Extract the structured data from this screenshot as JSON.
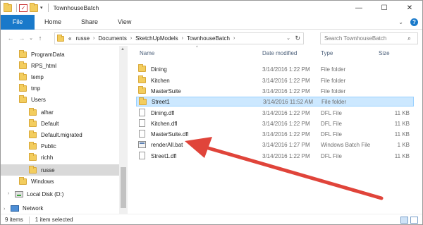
{
  "window": {
    "title": "TownhouseBatch",
    "controls": [
      "—",
      "☐",
      "✕"
    ]
  },
  "ribbon": {
    "file_tab": "File",
    "tabs": [
      "Home",
      "Share",
      "View"
    ]
  },
  "address": {
    "prefix": "«",
    "crumbs": [
      "russe",
      "Documents",
      "SketchUpModels",
      "TownhouseBatch"
    ]
  },
  "search": {
    "placeholder": "Search TownhouseBatch"
  },
  "nav_pane": {
    "items": [
      {
        "label": "ProgramData",
        "icon": "folder-icon"
      },
      {
        "label": "RPS_html",
        "icon": "folder-icon"
      },
      {
        "label": "temp",
        "icon": "folder-icon"
      },
      {
        "label": "tmp",
        "icon": "folder-icon"
      },
      {
        "label": "Users",
        "icon": "folder-icon"
      },
      {
        "label": "alhar",
        "icon": "folder-icon"
      },
      {
        "label": "Default",
        "icon": "folder-icon"
      },
      {
        "label": "Default.migrated",
        "icon": "folder-icon"
      },
      {
        "label": "Public",
        "icon": "folder-icon"
      },
      {
        "label": "richh",
        "icon": "folder-icon"
      },
      {
        "label": "russe",
        "icon": "folder-icon",
        "selected": true
      },
      {
        "label": "Windows",
        "icon": "folder-icon"
      },
      {
        "label": "Local Disk (D:)",
        "icon": "disk-icon"
      },
      {
        "label": "Network",
        "icon": "network-icon"
      }
    ]
  },
  "columns": {
    "name": "Name",
    "date": "Date modified",
    "type": "Type",
    "size": "Size"
  },
  "files": [
    {
      "name": "Dining",
      "date": "3/14/2016 1:22 PM",
      "type": "File folder",
      "size": "",
      "icon": "folder-icon"
    },
    {
      "name": "Kitchen",
      "date": "3/14/2016 1:22 PM",
      "type": "File folder",
      "size": "",
      "icon": "folder-icon"
    },
    {
      "name": "MasterSuite",
      "date": "3/14/2016 1:22 PM",
      "type": "File folder",
      "size": "",
      "icon": "folder-icon"
    },
    {
      "name": "Street1",
      "date": "3/14/2016 11:52 AM",
      "type": "File folder",
      "size": "",
      "icon": "folder-icon",
      "selected": true
    },
    {
      "name": "Dining.dfl",
      "date": "3/14/2016 1:22 PM",
      "type": "DFL File",
      "size": "11 KB",
      "icon": "document-icon"
    },
    {
      "name": "Kitchen.dfl",
      "date": "3/14/2016 1:22 PM",
      "type": "DFL File",
      "size": "11 KB",
      "icon": "document-icon"
    },
    {
      "name": "MasterSuite.dfl",
      "date": "3/14/2016 1:22 PM",
      "type": "DFL File",
      "size": "11 KB",
      "icon": "document-icon"
    },
    {
      "name": "renderAll.bat",
      "date": "3/14/2016 1:27 PM",
      "type": "Windows Batch File",
      "size": "1 KB",
      "icon": "batch-file-icon"
    },
    {
      "name": "Street1.dfl",
      "date": "3/14/2016 1:22 PM",
      "type": "DFL File",
      "size": "11 KB",
      "icon": "document-icon"
    }
  ],
  "status": {
    "item_count": "9 items",
    "selection": "1 item selected"
  },
  "colors": {
    "accent": "#1979ca",
    "selection_bg": "#cce8ff",
    "annotation_arrow": "#e0443a"
  }
}
